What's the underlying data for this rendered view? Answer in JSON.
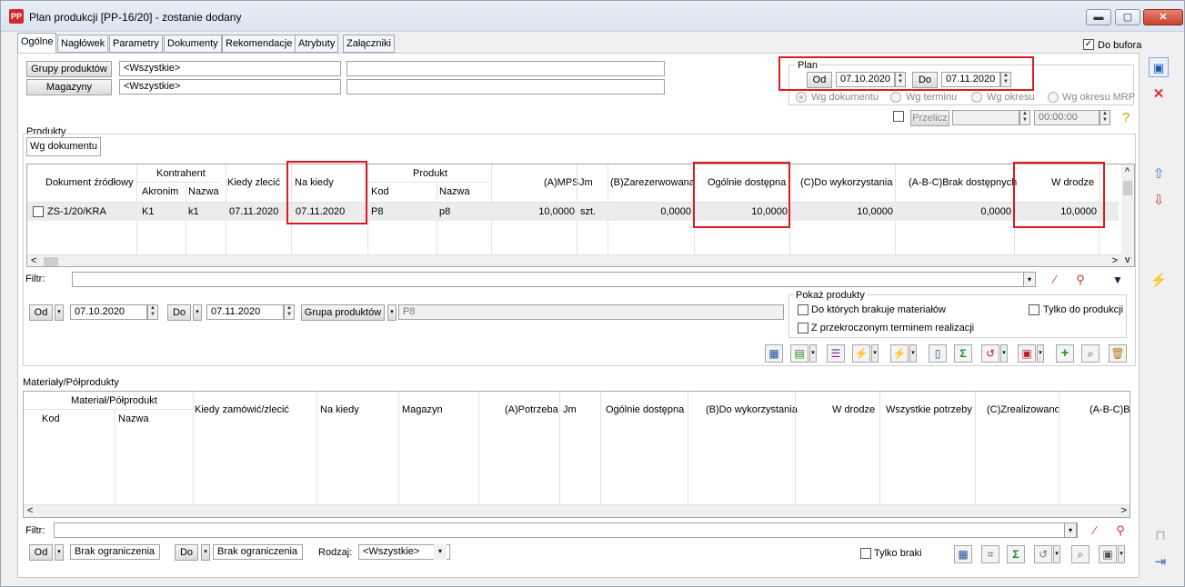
{
  "window": {
    "title": "Plan produkcji [PP-16/20] - zostanie dodany",
    "app_icon": "PP",
    "minimize": "▬",
    "maximize": "▢",
    "close": "✕"
  },
  "tabs": [
    "Ogólne",
    "Nagłówek",
    "Parametry",
    "Dokumenty",
    "Rekomendacje",
    "Atrybuty",
    "Załączniki"
  ],
  "do_bufora": {
    "label": "Do bufora",
    "checked": true
  },
  "filters": {
    "groups_btn": "Grupy produktów",
    "groups_value": "<Wszystkie>",
    "stores_btn": "Magazyny",
    "stores_value": "<Wszystkie>"
  },
  "plan": {
    "title": "Plan",
    "od_label": "Od",
    "od_value": "07.10.2020",
    "do_label": "Do",
    "do_value": "07.11.2020",
    "radios": [
      "Wg dokumentu",
      "Wg terminu",
      "Wg okresu",
      "Wg okresu MRP"
    ],
    "przelicz": "Przelicz",
    "time_value": "00:00:00"
  },
  "products": {
    "section_title": "Produkty",
    "subtab": "Wg dokumentu",
    "headers": {
      "doc": "Dokument źródłowy",
      "kontrahent": "Kontrahent",
      "akronim": "Akronim",
      "nazwa": "Nazwa",
      "kiedy": "Kiedy zlecić",
      "na_kiedy": "Na kiedy",
      "produkt": "Produkt",
      "kod": "Kod",
      "pnazwa": "Nazwa",
      "mps": "(A)MPS",
      "jm": "Jm",
      "zarez": "(B)Zarezerwowana",
      "ogolnie": "Ogólnie dostępna",
      "do_wyk": "(C)Do wykorzystania",
      "brak": "(A-B-C)Brak dostępnych",
      "w_drodze": "W drodze"
    },
    "row": {
      "doc": "ZS-1/20/KRA",
      "akronim": "K1",
      "nazwa": "k1",
      "kiedy": "07.11.2020",
      "na_kiedy": "07.11.2020",
      "kod": "P8",
      "pnazwa": "p8",
      "mps": "10,0000",
      "jm": "szt.",
      "zarez": "0,0000",
      "ogolnie": "10,0000",
      "do_wyk": "10,0000",
      "brak": "0,0000",
      "w_drodze": "10,0000"
    },
    "filtr_label": "Filtr:",
    "od_label": "Od",
    "od_value": "07.10.2020",
    "do_label": "Do",
    "do_value": "07.11.2020",
    "grupa_btn": "Grupa produktów",
    "grupa_value": "P8",
    "pokaz": {
      "title": "Pokaż produkty",
      "opt1": "Do których brakuje materiałów",
      "opt2": "Z przekroczonym terminem realizacji",
      "opt3": "Tylko do produkcji"
    }
  },
  "materials": {
    "section_title": "Materiały/Półprodukty",
    "headers": {
      "mat": "Materiał/Półprodukt",
      "kod": "Kod",
      "nazwa": "Nazwa",
      "kiedy": "Kiedy zamówić/zlecić",
      "na_kiedy": "Na kiedy",
      "magazyn": "Magazyn",
      "potrzeba": "(A)Potrzeba",
      "jm": "Jm",
      "ogolnie": "Ogólnie dostępna",
      "do_wyk": "(B)Do wykorzystania",
      "w_drodze": "W drodze",
      "wszystkie": "Wszystkie potrzeby",
      "zreal": "(C)Zrealizowano",
      "brak": "(A-B-C)Br"
    },
    "filtr_label": "Filtr:",
    "od_label": "Od",
    "od_value": "Brak ograniczenia",
    "do_label": "Do",
    "do_value": "Brak ograniczenia",
    "rodzaj_label": "Rodzaj:",
    "rodzaj_value": "<Wszystkie>",
    "tylko_braki": "Tylko braki"
  },
  "glyphs": {
    "check": "✓",
    "left": "<",
    "right": ">",
    "up": "^",
    "down": "v",
    "dd": "▾",
    "su": "▲",
    "sd": "▼"
  }
}
